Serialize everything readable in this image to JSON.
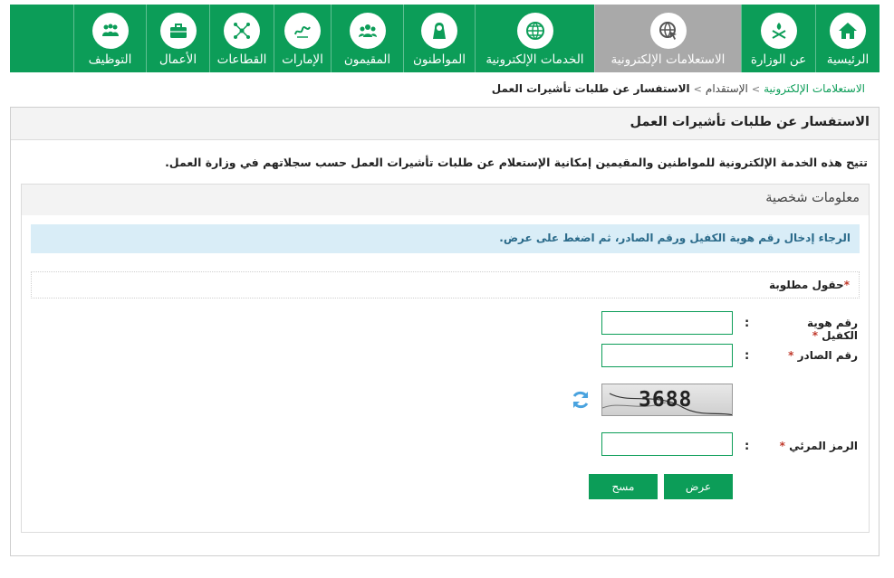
{
  "nav": {
    "items": [
      {
        "label": "الرئيسية",
        "icon": "home-icon"
      },
      {
        "label": "عن الوزارة",
        "icon": "emblem-icon"
      },
      {
        "label": "الاستعلامات الإلكترونية",
        "icon": "globe-cursor-icon",
        "active": true
      },
      {
        "label": "الخدمات الإلكترونية",
        "icon": "globe-icon"
      },
      {
        "label": "المواطنون",
        "icon": "citizen-icon"
      },
      {
        "label": "المقيمون",
        "icon": "group-icon"
      },
      {
        "label": "الإمارات",
        "icon": "vision-logo-icon"
      },
      {
        "label": "القطاعات",
        "icon": "network-icon"
      },
      {
        "label": "الأعمال",
        "icon": "briefcase-icon"
      },
      {
        "label": "التوظيف",
        "icon": "team-icon"
      }
    ]
  },
  "breadcrumb": {
    "home": "الاستعلامات الإلكترونية",
    "middle": "الإستقدام",
    "current": "الاستفسار عن طلبات تأشيرات العمل",
    "separator": ">"
  },
  "page": {
    "title": "الاستفسار عن طلبات تأشيرات العمل",
    "intro": "تتيح هذه الخدمة الإلكترونية للمواطنين والمقيمين إمكانية الإستعلام عن طلبات تأشيرات العمل حسب سجلاتهم في وزارة العمل."
  },
  "form": {
    "section_title": "معلومات شخصية",
    "info_message": "الرجاء إدخال رقم هوية الكفيل ورقم الصادر، ثم اضغط على عرض.",
    "required_note": "حقول مطلوبة",
    "required_star": "*",
    "colon": ":",
    "sponsor_id_label": "رقم هوية الكفيل",
    "sponsor_id_value": "",
    "outgoing_no_label": "رقم الصادر",
    "outgoing_no_value": "",
    "captcha_label": "الرمز المرئي",
    "captcha_value": "",
    "captcha_image_text": "3688",
    "submit_label": "عرض",
    "clear_label": "مسح"
  },
  "colors": {
    "brand_green": "#0c9d58",
    "active_tab": "#a9a9a9",
    "info_bg": "#d9edf7",
    "info_text": "#2a6a8a",
    "required_star": "#c0392b",
    "refresh_icon": "#4aa3df"
  }
}
